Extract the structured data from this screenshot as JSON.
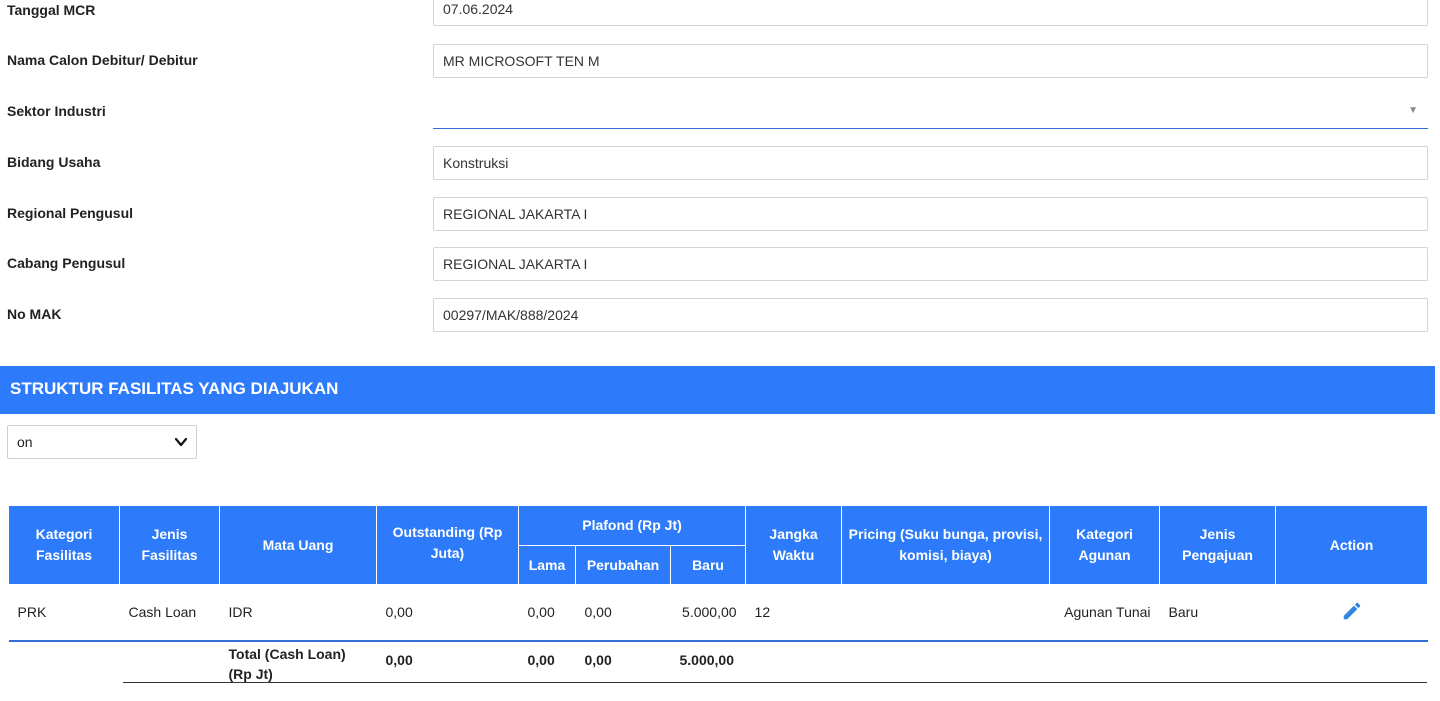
{
  "form": {
    "tanggal_mcr": {
      "label": "Tanggal MCR",
      "value": "07.06.2024"
    },
    "nama_debitur": {
      "label": "Nama Calon Debitur/ Debitur",
      "value": "MR MICROSOFT TEN M"
    },
    "sektor_industri": {
      "label": "Sektor Industri",
      "value": ""
    },
    "bidang_usaha": {
      "label": "Bidang Usaha",
      "value": "Konstruksi"
    },
    "regional_pengusul": {
      "label": "Regional Pengusul",
      "value": "REGIONAL JAKARTA I"
    },
    "cabang_pengusul": {
      "label": "Cabang Pengusul",
      "value": "REGIONAL JAKARTA I"
    },
    "no_mak": {
      "label": "No MAK",
      "value": "00297/MAK/888/2024"
    }
  },
  "section": {
    "title": "STRUKTUR FASILITAS YANG DIAJUKAN",
    "select_value": "on"
  },
  "table": {
    "headers": {
      "kategori_fasilitas": "Kategori Fasilitas",
      "jenis_fasilitas": "Jenis Fasilitas",
      "mata_uang": "Mata Uang",
      "outstanding": "Outstanding (Rp Juta)",
      "plafond": "Plafond (Rp Jt)",
      "lama": "Lama",
      "perubahan": "Perubahan",
      "baru": "Baru",
      "jangka_waktu": "Jangka Waktu",
      "pricing": "Pricing (Suku bunga, provisi, komisi, biaya)",
      "kategori_agunan": "Kategori Agunan",
      "jenis_pengajuan": "Jenis Pengajuan",
      "action": "Action"
    },
    "rows": [
      {
        "kategori_fasilitas": "PRK",
        "jenis_fasilitas": "Cash Loan",
        "mata_uang": "IDR",
        "outstanding": "0,00",
        "lama": "0,00",
        "perubahan": "0,00",
        "baru": "5.000,00",
        "jangka_waktu": "12",
        "pricing": "",
        "kategori_agunan": "Agunan Tunai",
        "jenis_pengajuan": "Baru",
        "action_icon": "pencil-icon"
      }
    ],
    "total": {
      "label": "Total (Cash Loan) (Rp Jt)",
      "outstanding": "0,00",
      "lama": "0,00",
      "perubahan": "0,00",
      "baru": "5.000,00"
    }
  },
  "colors": {
    "accent": "#2d7bfb",
    "underline": "#2f6fd6",
    "edit_icon": "#2f86e0"
  }
}
